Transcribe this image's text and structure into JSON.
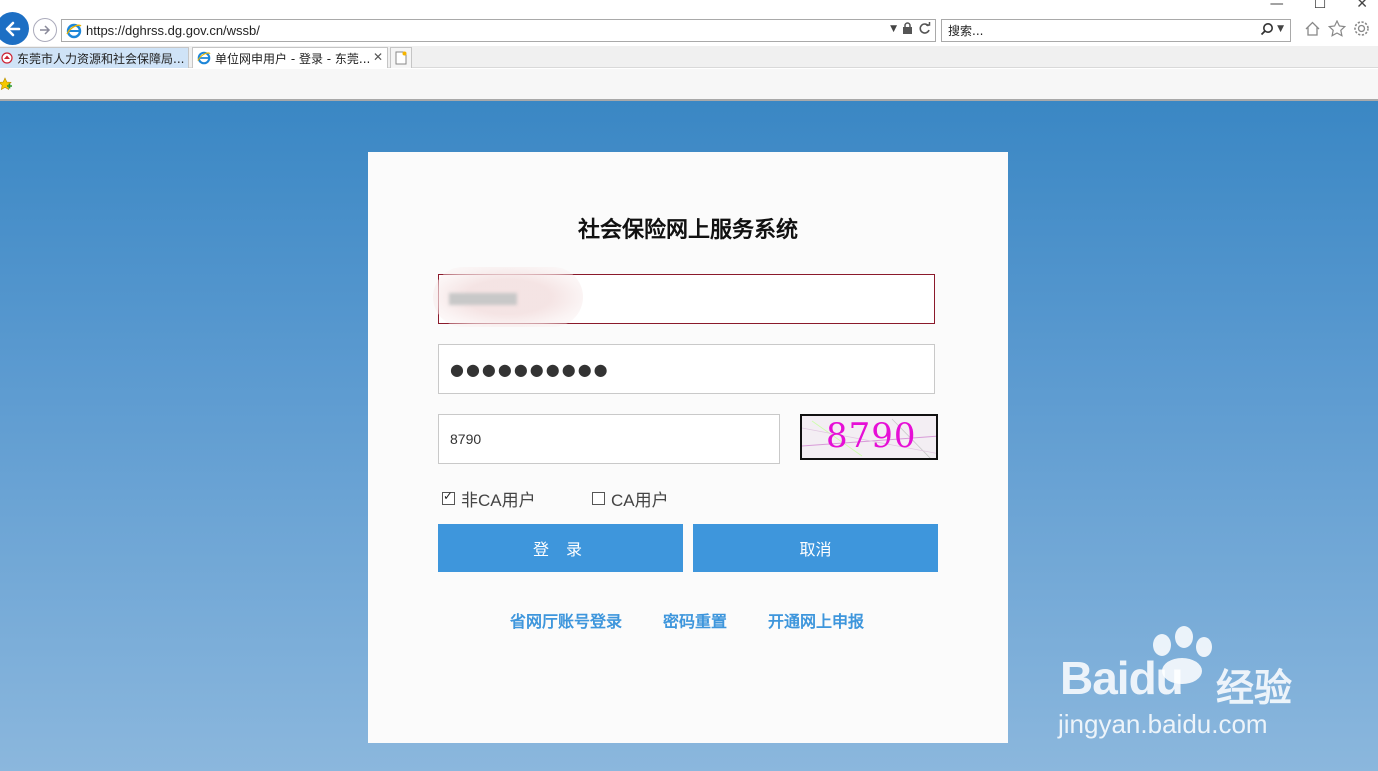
{
  "browser": {
    "url": "https://dghrss.dg.gov.cn/wssb/",
    "search_placeholder": "搜索...",
    "tabs": [
      {
        "label": "东莞市人力资源和社会保障局..."
      },
      {
        "label": "单位网申用户 - 登录 - 东莞..."
      }
    ],
    "tab_close": "✕"
  },
  "login": {
    "title": "社会保险网上服务系统",
    "password_mask": "●●●●●●●●●●",
    "captcha_value": "8790",
    "captcha_image_text": "8790",
    "checkbox_nonca_label": "非CA用户",
    "checkbox_nonca_checked": true,
    "checkbox_ca_label": "CA用户",
    "checkbox_ca_checked": false,
    "login_button": "登 录",
    "cancel_button": "取消",
    "links": [
      "省网厅账号登录",
      "密码重置",
      "开通网上申报"
    ]
  },
  "watermark": {
    "logo": "Baidu",
    "cn": "经验",
    "url": "jingyan.baidu.com"
  },
  "colors": {
    "accent": "#3e96dc",
    "captcha_text": "#e60fd6",
    "background_top": "#3a87c4",
    "background_bottom": "#8bb7dd"
  }
}
